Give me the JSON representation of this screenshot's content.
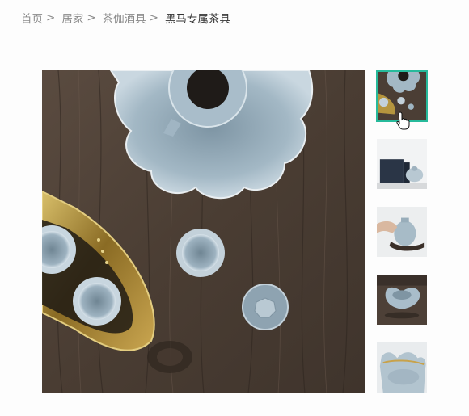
{
  "breadcrumb": {
    "items": [
      {
        "label": "首页"
      },
      {
        "label": "居家"
      },
      {
        "label": "茶伽酒具"
      }
    ],
    "separator": ">",
    "current": "黑马专属茶具"
  },
  "gallery": {
    "main_image": "tea-set-top-view-wooden-table",
    "thumbnails": [
      {
        "image": "tea-set-top-view",
        "active": true
      },
      {
        "image": "gift-box-with-teapot",
        "active": false
      },
      {
        "image": "hand-holding-teapot",
        "active": false
      },
      {
        "image": "lotus-bowl-on-wood",
        "active": false
      },
      {
        "image": "celadon-cup-closeup",
        "active": false
      }
    ],
    "active_border_color": "#27ba9b"
  },
  "colors": {
    "breadcrumb_link": "#8a8a8a",
    "breadcrumb_current": "#333333",
    "wood": "#4f4239",
    "celadon": "#9fb5c2",
    "gold": "#b5953e"
  }
}
